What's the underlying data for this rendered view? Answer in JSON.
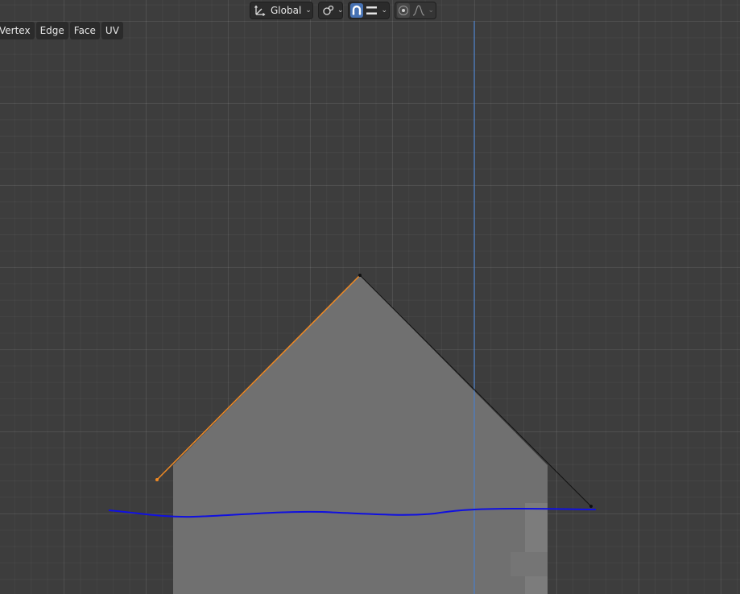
{
  "toolbar": {
    "transform_orientation": "Global",
    "orientation_icon": "transform-orientation-icon",
    "pivot_icon": "pivot-point-icon",
    "snap_icon": "snap-magnet-icon",
    "snap_target_icon": "snap-increment-icon",
    "proportional_icon": "proportional-editing-icon",
    "falloff_icon": "falloff-curve-icon"
  },
  "menu": {
    "items": [
      "Vertex",
      "Edge",
      "Face",
      "UV"
    ]
  },
  "colors": {
    "background": "#3d3d3d",
    "face_fill": "#707070",
    "selected_edge": "#f08a24",
    "axis_line": "#4a7fc9",
    "annotation_stroke": "#1010e0",
    "active_button": "#4772b3"
  }
}
